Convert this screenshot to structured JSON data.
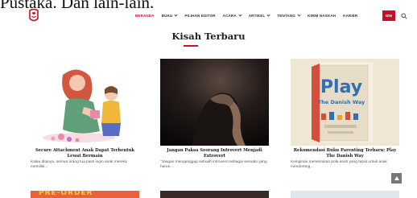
{
  "page": {
    "caption": "Pustaka. Dan lain-lain."
  },
  "nav": {
    "items": [
      {
        "label": "BERANDA",
        "active": true,
        "dropdown": false
      },
      {
        "label": "BUKU",
        "active": false,
        "dropdown": true
      },
      {
        "label": "PILIHAN EDITOR",
        "active": false,
        "dropdown": false
      },
      {
        "label": "ACARA",
        "active": false,
        "dropdown": true
      },
      {
        "label": "ARTIKEL",
        "active": false,
        "dropdown": true
      },
      {
        "label": "TENTANG",
        "active": false,
        "dropdown": true
      },
      {
        "label": "KIRIM NASKAH",
        "active": false,
        "dropdown": false
      },
      {
        "label": "KARIER",
        "active": false,
        "dropdown": false
      }
    ],
    "lang_label": "IDN",
    "accent_color": "#c8102e"
  },
  "section": {
    "title": "Kisah Terbaru"
  },
  "cards": [
    {
      "title": "Secure Attachment Anak Dapat Terbentuk Lewat Bermain",
      "excerpt": "Kalau ditanya, semua orang tua pasti ingin anak mereka memiliki..."
    },
    {
      "title": "Jangan Paksa Seorang Introvert Menjadi Extrovert",
      "excerpt": "\"Jangan menganggap sebuah introversi sebagai sesuatu yang harus..."
    },
    {
      "title": "Rekomendasi Buku Parenting Terbaru: Play The Danish Way",
      "excerpt": "Keinginan menemukan pola asuh yang tepat untuk anak mendorong..."
    }
  ],
  "book_cover": {
    "word": "Play",
    "subtitle": "The Danish Way"
  },
  "bottom_thumbs": [
    {
      "text": "PRE-ORDER"
    },
    {
      "text": ""
    },
    {
      "text": ""
    }
  ]
}
